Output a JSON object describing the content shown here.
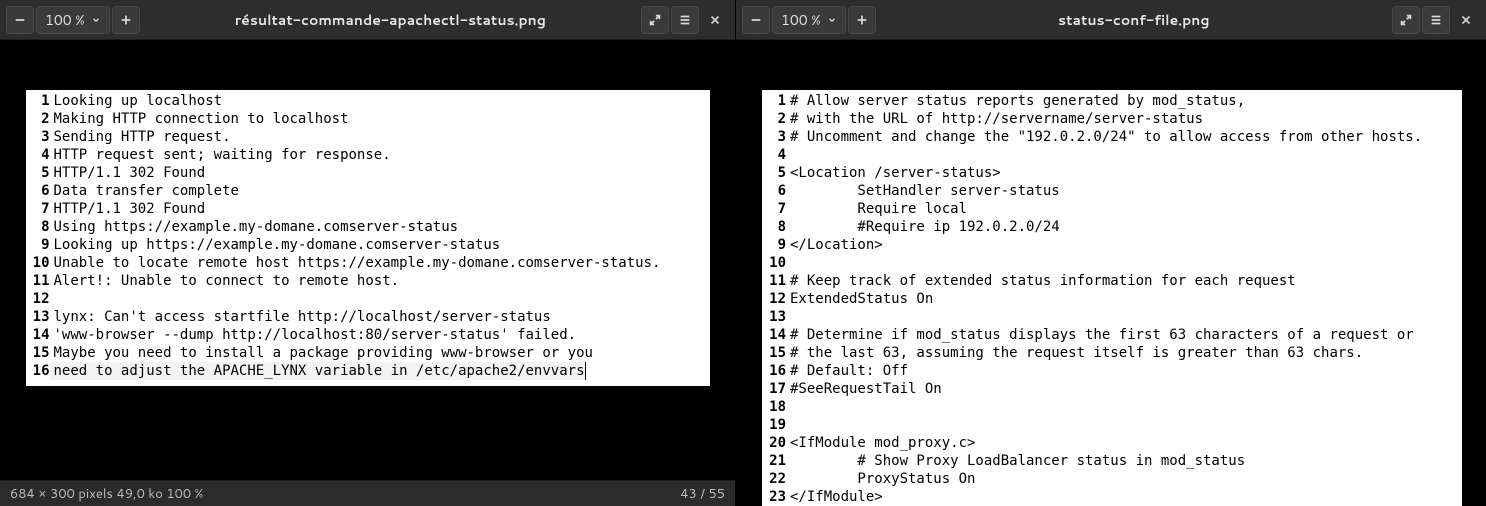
{
  "left": {
    "toolbar": {
      "zoom_out_icon": "minus",
      "zoom_label": "100 %",
      "zoom_in_icon": "plus",
      "title": "résultat-commande-apachectl-status.png",
      "fullscreen_icon": "fullscreen",
      "menu_icon": "hamburger",
      "close_icon": "close"
    },
    "content_lines": [
      "Looking up localhost",
      "Making HTTP connection to localhost",
      "Sending HTTP request.",
      "HTTP request sent; waiting for response.",
      "HTTP/1.1 302 Found",
      "Data transfer complete",
      "HTTP/1.1 302 Found",
      "Using https://example.my-domane.comserver-status",
      "Looking up https://example.my-domane.comserver-status",
      "Unable to locate remote host https://example.my-domane.comserver-status.",
      "Alert!: Unable to connect to remote host.",
      "",
      "lynx: Can't access startfile http://localhost/server-status",
      "'www-browser --dump http://localhost:80/server-status' failed.",
      "Maybe you need to install a package providing www-browser or you",
      "need to adjust the APACHE_LYNX variable in /etc/apache2/envvars"
    ],
    "highlight_line_index": 15,
    "status_left": "684 × 300 pixels   49,0 ko   100 %",
    "status_right": "43 / 55"
  },
  "right": {
    "toolbar": {
      "zoom_out_icon": "minus",
      "zoom_label": "100 %",
      "zoom_in_icon": "plus",
      "title": "status-conf-file.png",
      "fullscreen_icon": "fullscreen",
      "menu_icon": "hamburger",
      "close_icon": "close"
    },
    "content_lines": [
      "# Allow server status reports generated by mod_status,",
      "# with the URL of http://servername/server-status",
      "# Uncomment and change the \"192.0.2.0/24\" to allow access from other hosts.",
      "",
      "<Location /server-status>",
      "        SetHandler server-status",
      "        Require local",
      "        #Require ip 192.0.2.0/24",
      "</Location>",
      "",
      "# Keep track of extended status information for each request",
      "ExtendedStatus On",
      "",
      "# Determine if mod_status displays the first 63 characters of a request or",
      "# the last 63, assuming the request itself is greater than 63 chars.",
      "# Default: Off",
      "#SeeRequestTail On",
      "",
      "",
      "<IfModule mod_proxy.c>",
      "        # Show Proxy LoadBalancer status in mod_status",
      "        ProxyStatus On",
      "</IfModule>"
    ]
  }
}
